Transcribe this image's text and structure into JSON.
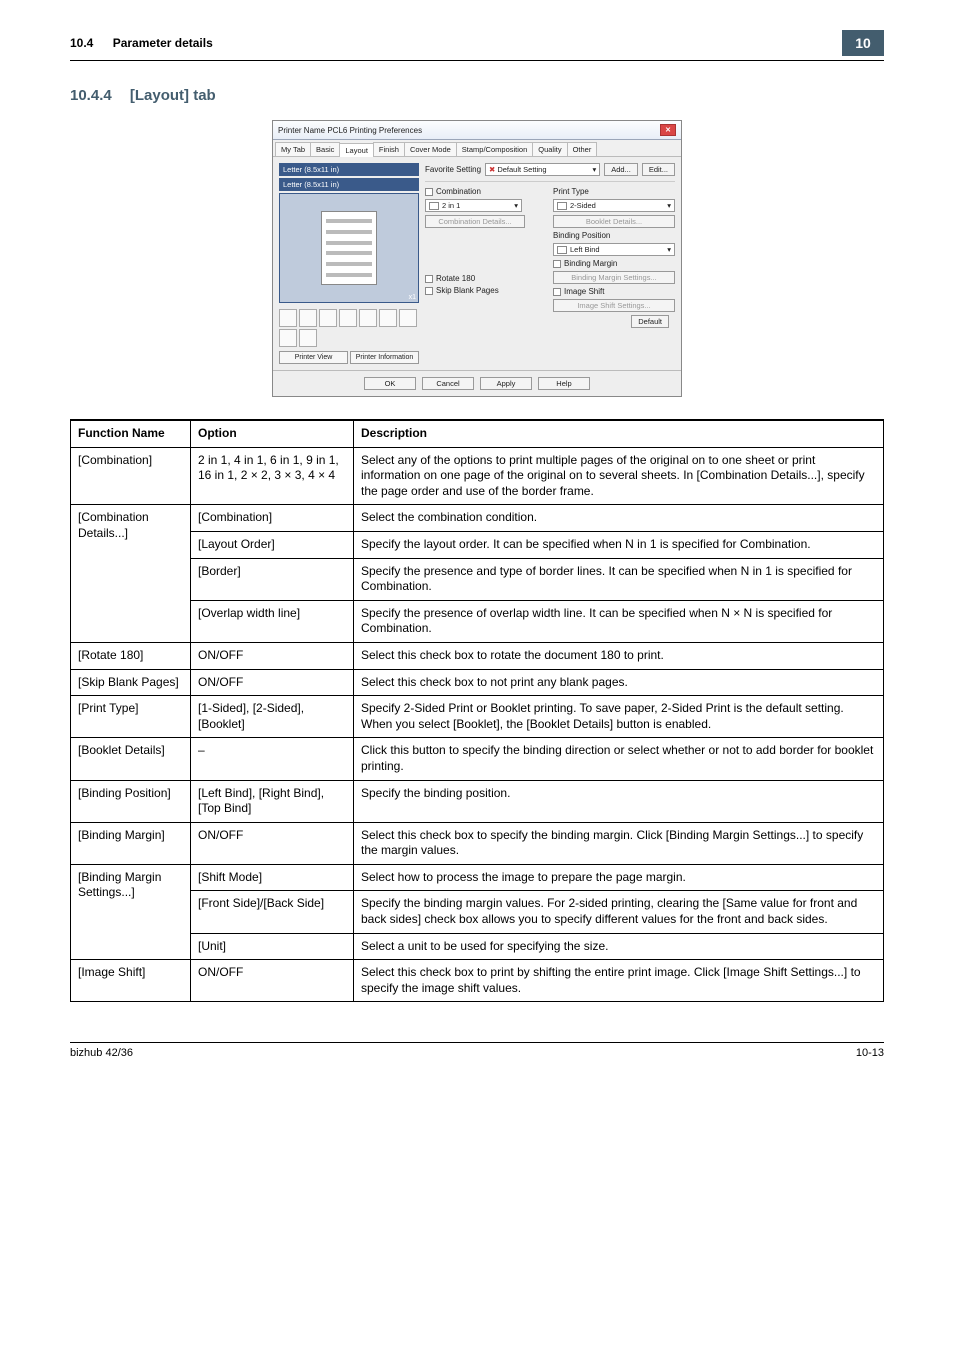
{
  "header": {
    "section_num": "10.4",
    "section_title": "Parameter details",
    "chapter": "10"
  },
  "heading": {
    "num": "10.4.4",
    "title": "[Layout] tab"
  },
  "dialog": {
    "title": "Printer Name PCL6 Printing Preferences",
    "tabs": [
      "My Tab",
      "Basic",
      "Layout",
      "Finish",
      "Cover Mode",
      "Stamp/Composition",
      "Quality",
      "Other"
    ],
    "selected_tab_index": 2,
    "preview_title1": "Letter (8.5x11 in)",
    "preview_title2": "Letter (8.5x11 in)",
    "x1": "x1",
    "printer_view": "Printer View",
    "printer_info": "Printer Information",
    "fav_label": "Favorite Setting",
    "fav_value": "Default Setting",
    "add": "Add...",
    "edit": "Edit...",
    "combination": "Combination",
    "combo_val": "2 in 1",
    "combo_details": "Combination Details...",
    "rotate180": "Rotate 180",
    "skip_blank": "Skip Blank Pages",
    "print_type": "Print Type",
    "print_type_val": "2-Sided",
    "booklet_details": "Booklet Details...",
    "binding_pos": "Binding Position",
    "binding_pos_val": "Left Bind",
    "binding_margin": "Binding Margin",
    "binding_margin_settings": "Binding Margin Settings...",
    "image_shift": "Image Shift",
    "image_shift_settings": "Image Shift Settings...",
    "default": "Default",
    "ok": "OK",
    "cancel": "Cancel",
    "apply": "Apply",
    "help": "Help"
  },
  "table": {
    "headers": [
      "Function Name",
      "Option",
      "Description"
    ],
    "rows": [
      {
        "fn": "[Combination]",
        "fn_rowspan": 1,
        "opt": "2 in 1, 4 in 1, 6 in 1, 9 in 1, 16 in 1, 2 × 2, 3 × 3, 4 × 4",
        "desc": "Select any of the options to print multiple pages of the original on to one sheet or print information on one page of the original on to several sheets. In [Combination Details...], specify the page order and use of the border frame."
      },
      {
        "fn": "[Combination Details...]",
        "fn_rowspan": 4,
        "opt": "[Combination]",
        "desc": "Select the combination condition."
      },
      {
        "opt": "[Layout Order]",
        "desc": "Specify the layout order. It can be specified when N in 1 is specified for Combination."
      },
      {
        "opt": "[Border]",
        "desc": "Specify the presence and type of border lines. It can be specified when N in 1 is specified for Combination."
      },
      {
        "opt": "[Overlap width line]",
        "desc": "Specify the presence of overlap width line. It can be specified when N × N is specified for Combination."
      },
      {
        "fn": "[Rotate 180]",
        "fn_rowspan": 1,
        "opt": "ON/OFF",
        "desc": "Select this check box to rotate the document 180 to print."
      },
      {
        "fn": "[Skip Blank Pages]",
        "fn_rowspan": 1,
        "opt": "ON/OFF",
        "desc": "Select this check box to not print any blank pages."
      },
      {
        "fn": "[Print Type]",
        "fn_rowspan": 1,
        "opt": "[1-Sided], [2-Sided], [Booklet]",
        "desc": "Specify 2-Sided Print or Booklet printing. To save paper, 2-Sided Print is the default setting.\nWhen you select [Booklet], the [Booklet Details] button is enabled."
      },
      {
        "fn": "[Booklet Details]",
        "fn_rowspan": 1,
        "opt": "–",
        "desc": "Click this button to specify the binding direction or select whether or not to add border for booklet printing."
      },
      {
        "fn": "[Binding Position]",
        "fn_rowspan": 1,
        "opt": "[Left Bind], [Right Bind], [Top Bind]",
        "desc": "Specify the binding position."
      },
      {
        "fn": "[Binding Margin]",
        "fn_rowspan": 1,
        "opt": "ON/OFF",
        "desc": "Select this check box to specify the binding margin. Click [Binding Margin Settings...] to specify the margin values."
      },
      {
        "fn": "[Binding Margin Settings...]",
        "fn_rowspan": 3,
        "opt": "[Shift Mode]",
        "desc": "Select how to process the image to prepare the page margin."
      },
      {
        "opt": "[Front Side]/[Back Side]",
        "desc": "Specify the binding margin values. For 2-sided printing, clearing the [Same value for front and back sides] check box allows you to specify different values for the front and back sides."
      },
      {
        "opt": "[Unit]",
        "desc": "Select a unit to be used for specifying the size."
      },
      {
        "fn": "[Image Shift]",
        "fn_rowspan": 1,
        "opt": "ON/OFF",
        "desc": "Select this check box to print by shifting the entire print image. Click [Image Shift Settings...] to specify the image shift values."
      }
    ]
  },
  "footer": {
    "model": "bizhub 42/36",
    "page": "10-13"
  }
}
